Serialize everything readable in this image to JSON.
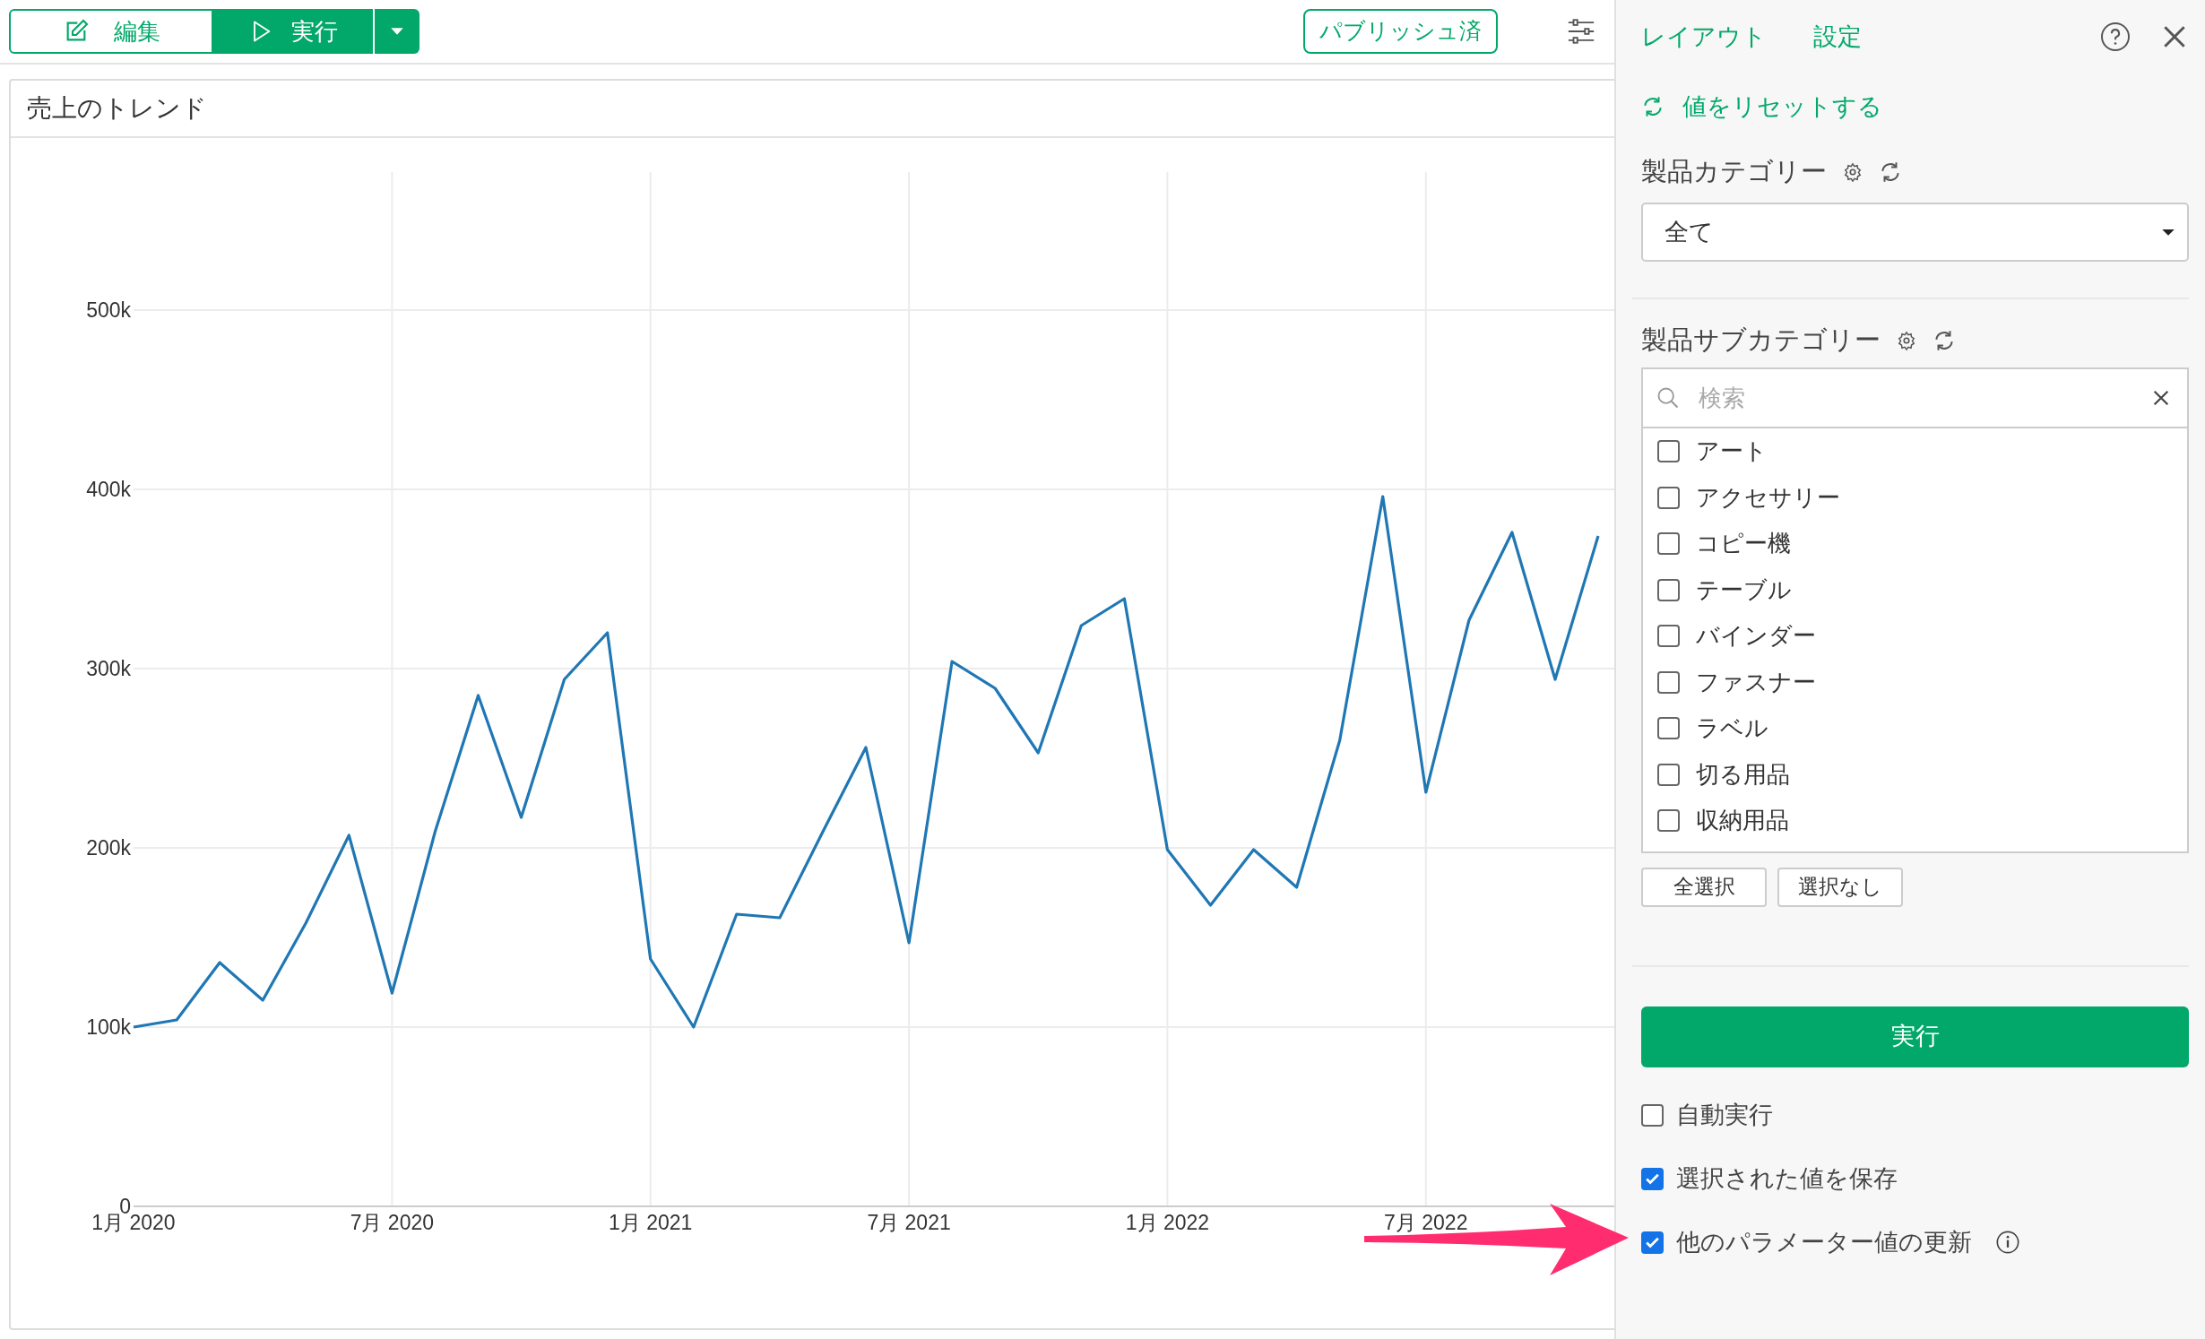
{
  "toolbar": {
    "buttons": [
      {
        "kind": "edit",
        "label": "編集"
      },
      {
        "kind": "run",
        "label": "実行"
      },
      {
        "kind": "dropdown"
      }
    ],
    "status_badge": "パブリッシュ済"
  },
  "chart_card": {
    "title": "売上のトレンド",
    "chart_data": {
      "type": "line",
      "grid": true,
      "categories": [
        "1月 2020",
        null,
        null,
        null,
        null,
        null,
        "7月 2020",
        null,
        null,
        null,
        null,
        null,
        "1月 2021",
        null,
        null,
        null,
        null,
        null,
        "7月 2021",
        null,
        null,
        null,
        null,
        null,
        "1月 2022",
        null,
        null,
        null,
        null,
        null,
        "7月 2022",
        null,
        null,
        null,
        null
      ],
      "series": [
        {
          "color": "#1f77b4",
          "values": [
            100000,
            104000,
            136000,
            115000,
            158000,
            207000,
            119000,
            209000,
            285000,
            217000,
            294000,
            320000,
            138000,
            100000,
            163000,
            161000,
            209000,
            256000,
            147000,
            304000,
            289000,
            253000,
            324000,
            339000,
            199000,
            168000,
            199000,
            178000,
            260000,
            396000,
            231000,
            327000,
            376000,
            294000,
            374000
          ]
        }
      ],
      "ylim": [
        0,
        577000
      ],
      "yticks": [
        {
          "value": 0,
          "label": "0"
        },
        {
          "value": 100000,
          "label": "100k"
        },
        {
          "value": 200000,
          "label": "200k"
        },
        {
          "value": 300000,
          "label": "300k"
        },
        {
          "value": 400000,
          "label": "400k"
        },
        {
          "value": 500000,
          "label": "500k"
        }
      ]
    }
  },
  "panel": {
    "tabs": [
      "レイアウト",
      "設定"
    ],
    "reset_link": "値をリセットする",
    "parameters": [
      {
        "kind": "select",
        "label": "製品カテゴリー",
        "value": "全て"
      },
      {
        "kind": "checklist",
        "label": "製品サブカテゴリー",
        "placeholder": "検索",
        "options": [
          {
            "label": "アート",
            "checked": false
          },
          {
            "label": "アクセサリー",
            "checked": false
          },
          {
            "label": "コピー機",
            "checked": false
          },
          {
            "label": "テーブル",
            "checked": false
          },
          {
            "label": "バインダー",
            "checked": false
          },
          {
            "label": "ファスナー",
            "checked": false
          },
          {
            "label": "ラベル",
            "checked": false
          },
          {
            "label": "切る用品",
            "checked": false
          },
          {
            "label": "収納用品",
            "checked": false
          }
        ],
        "buttons": [
          "全選択",
          "選択なし"
        ]
      }
    ],
    "run_button": "実行",
    "options": [
      {
        "label": "自動実行",
        "checked": false,
        "info": false
      },
      {
        "label": "選択された値を保存",
        "checked": true,
        "info": false
      },
      {
        "label": "他のパラメーター値の更新",
        "checked": true,
        "info": true
      }
    ]
  }
}
